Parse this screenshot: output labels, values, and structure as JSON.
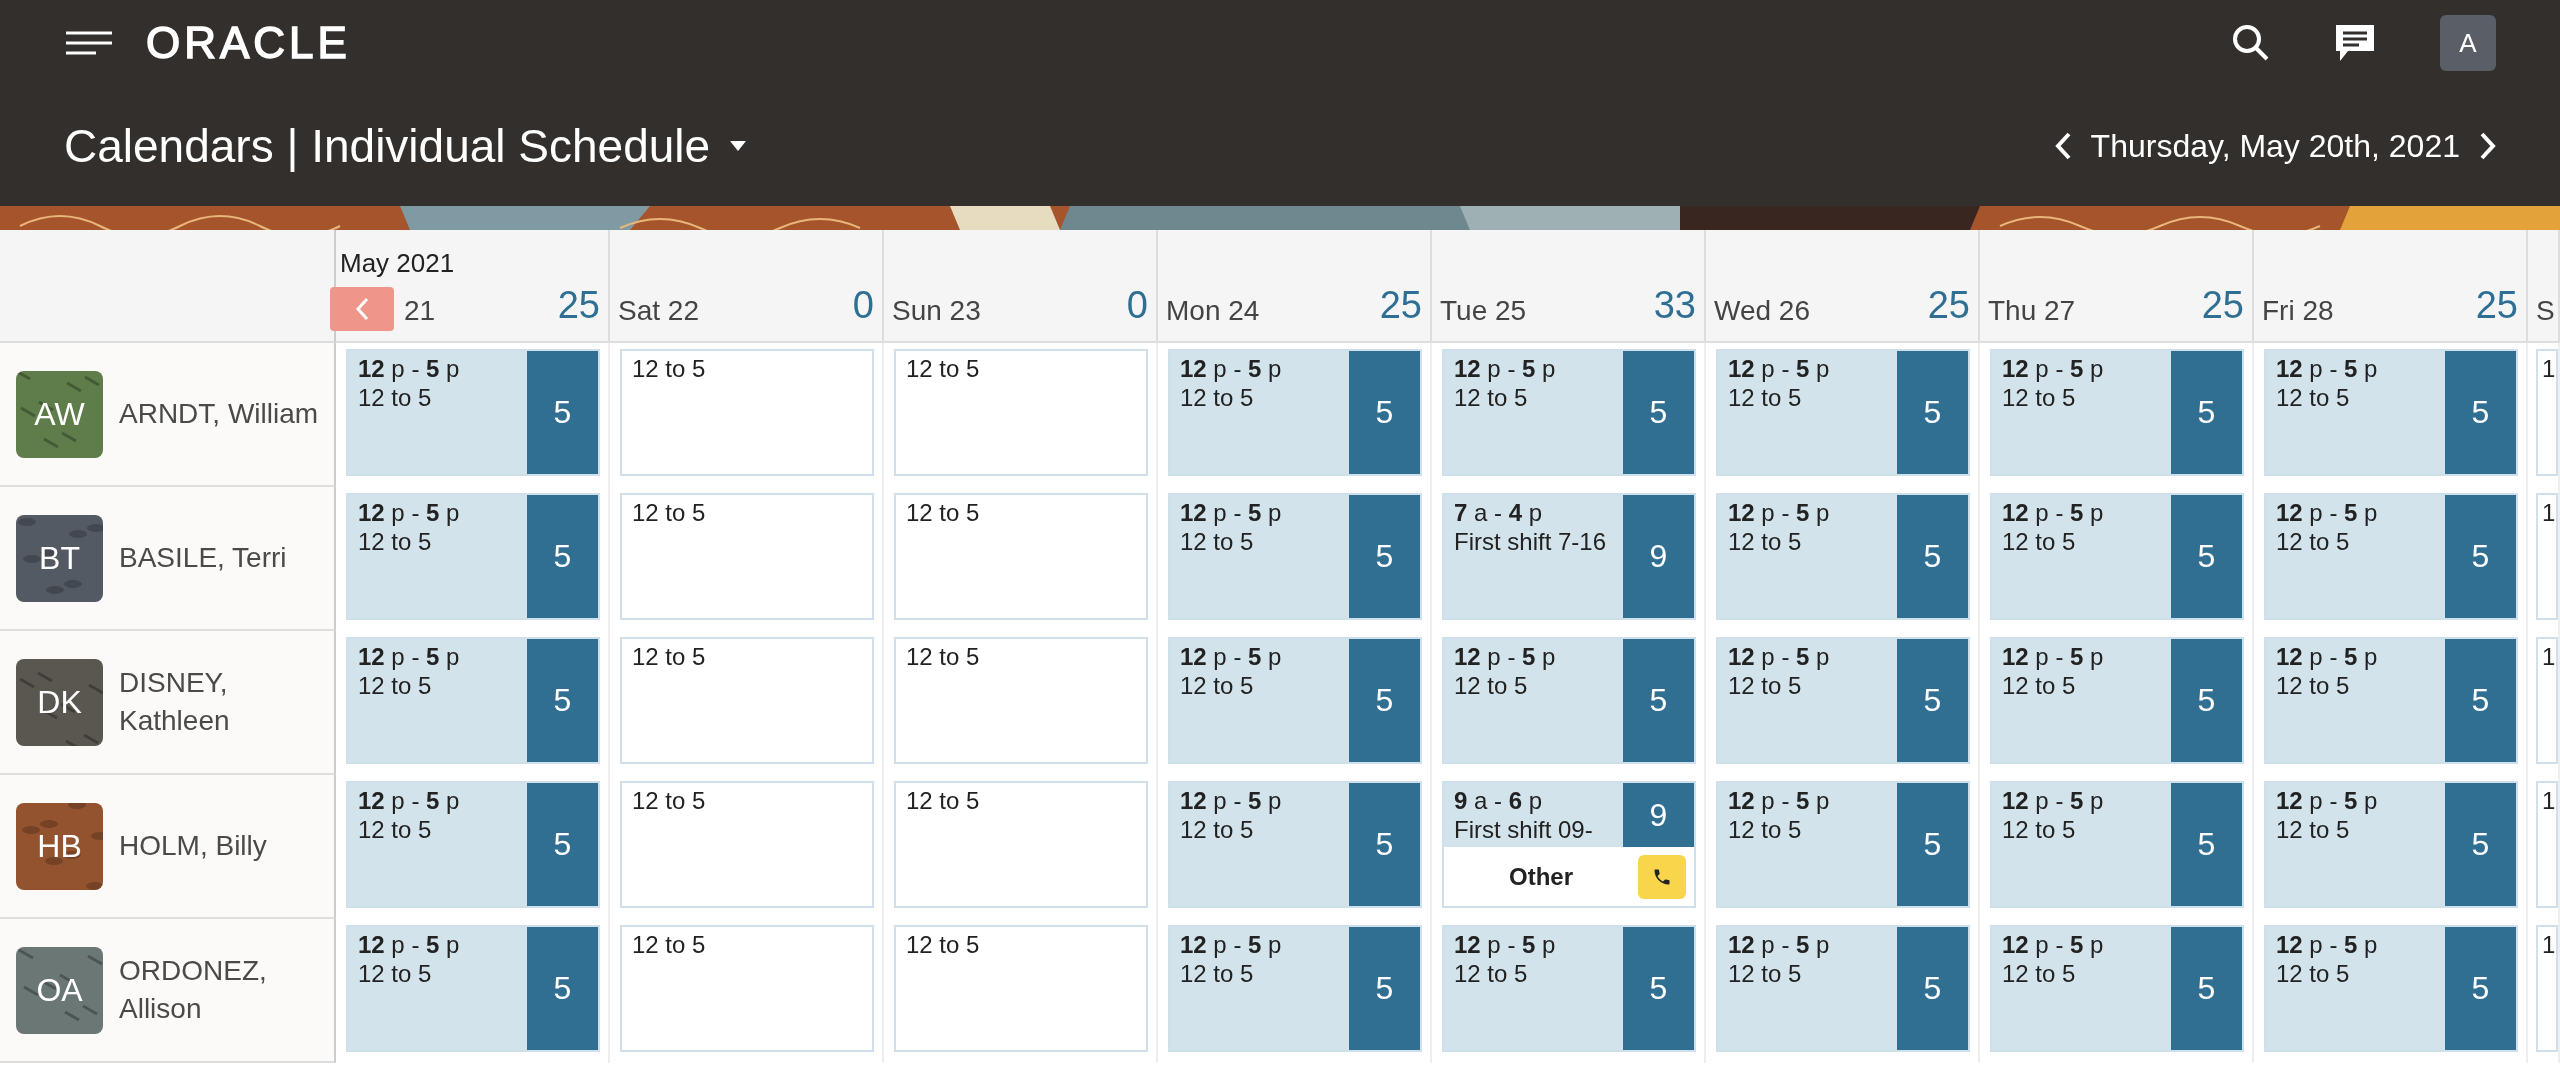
{
  "header": {
    "logo": "ORACLE",
    "title": "Calendars | Individual Schedule",
    "date": "Thursday, May 20th, 2021",
    "user_initial": "A"
  },
  "calendar": {
    "month": "May 2021",
    "days": [
      {
        "label": "21",
        "total": "25"
      },
      {
        "label": "Sat 22",
        "total": "0"
      },
      {
        "label": "Sun 23",
        "total": "0"
      },
      {
        "label": "Mon 24",
        "total": "25"
      },
      {
        "label": "Tue 25",
        "total": "33"
      },
      {
        "label": "Wed 26",
        "total": "25"
      },
      {
        "label": "Thu 27",
        "total": "25"
      },
      {
        "label": "Fri 28",
        "total": "25"
      },
      {
        "label": "S"
      }
    ],
    "people": [
      {
        "initials": "AW",
        "name": "ARNDT, William",
        "color": "#5e7d4a",
        "cells": [
          {
            "kind": "shift",
            "time": "**12** p - **5** p",
            "note": "12 to 5",
            "count": "5"
          },
          {
            "kind": "plain",
            "note": "12 to 5"
          },
          {
            "kind": "plain",
            "note": "12 to 5"
          },
          {
            "kind": "shift",
            "time": "**12** p - **5** p",
            "note": "12 to 5",
            "count": "5"
          },
          {
            "kind": "shift",
            "time": "**12** p - **5** p",
            "note": "12 to 5",
            "count": "5"
          },
          {
            "kind": "shift",
            "time": "**12** p - **5** p",
            "note": "12 to 5",
            "count": "5"
          },
          {
            "kind": "shift",
            "time": "**12** p - **5** p",
            "note": "12 to 5",
            "count": "5"
          },
          {
            "kind": "shift",
            "time": "**12** p - **5** p",
            "note": "12 to 5",
            "count": "5"
          },
          {
            "kind": "plain",
            "note": "1"
          }
        ]
      },
      {
        "initials": "BT",
        "name": "BASILE, Terri",
        "color": "#545a64",
        "cells": [
          {
            "kind": "shift",
            "time": "**12** p - **5** p",
            "note": "12 to 5",
            "count": "5"
          },
          {
            "kind": "plain",
            "note": "12 to 5"
          },
          {
            "kind": "plain",
            "note": "12 to 5"
          },
          {
            "kind": "shift",
            "time": "**12** p - **5** p",
            "note": "12 to 5",
            "count": "5"
          },
          {
            "kind": "shift",
            "time": "**7** a - **4** p",
            "note": "First shift 7-16",
            "count": "9"
          },
          {
            "kind": "shift",
            "time": "**12** p - **5** p",
            "note": "12 to 5",
            "count": "5"
          },
          {
            "kind": "shift",
            "time": "**12** p - **5** p",
            "note": "12 to 5",
            "count": "5"
          },
          {
            "kind": "shift",
            "time": "**12** p - **5** p",
            "note": "12 to 5",
            "count": "5"
          },
          {
            "kind": "plain",
            "note": "1"
          }
        ]
      },
      {
        "initials": "DK",
        "name": "DISNEY, Kathleen",
        "color": "#5a5650",
        "cells": [
          {
            "kind": "shift",
            "time": "**12** p - **5** p",
            "note": "12 to 5",
            "count": "5"
          },
          {
            "kind": "plain",
            "note": "12 to 5"
          },
          {
            "kind": "plain",
            "note": "12 to 5"
          },
          {
            "kind": "shift",
            "time": "**12** p - **5** p",
            "note": "12 to 5",
            "count": "5"
          },
          {
            "kind": "shift",
            "time": "**12** p - **5** p",
            "note": "12 to 5",
            "count": "5"
          },
          {
            "kind": "shift",
            "time": "**12** p - **5** p",
            "note": "12 to 5",
            "count": "5"
          },
          {
            "kind": "shift",
            "time": "**12** p - **5** p",
            "note": "12 to 5",
            "count": "5"
          },
          {
            "kind": "shift",
            "time": "**12** p - **5** p",
            "note": "12 to 5",
            "count": "5"
          },
          {
            "kind": "plain",
            "note": "1"
          }
        ]
      },
      {
        "initials": "HB",
        "name": "HOLM, Billy",
        "color": "#93532f",
        "cells": [
          {
            "kind": "shift",
            "time": "**12** p - **5** p",
            "note": "12 to 5",
            "count": "5"
          },
          {
            "kind": "plain",
            "note": "12 to 5"
          },
          {
            "kind": "plain",
            "note": "12 to 5"
          },
          {
            "kind": "shift",
            "time": "**12** p - **5** p",
            "note": "12 to 5",
            "count": "5"
          },
          {
            "kind": "shift_other",
            "time": "**9** a - **6** p",
            "note": "First shift 09-",
            "count": "9",
            "other": "Other"
          },
          {
            "kind": "shift",
            "time": "**12** p - **5** p",
            "note": "12 to 5",
            "count": "5"
          },
          {
            "kind": "shift",
            "time": "**12** p - **5** p",
            "note": "12 to 5",
            "count": "5"
          },
          {
            "kind": "shift",
            "time": "**12** p - **5** p",
            "note": "12 to 5",
            "count": "5"
          },
          {
            "kind": "plain",
            "note": "1"
          }
        ]
      },
      {
        "initials": "OA",
        "name": "ORDONEZ, Allison",
        "color": "#6b7775",
        "cells": [
          {
            "kind": "shift",
            "time": "**12** p - **5** p",
            "note": "12 to 5",
            "count": "5"
          },
          {
            "kind": "plain",
            "note": "12 to 5"
          },
          {
            "kind": "plain",
            "note": "12 to 5"
          },
          {
            "kind": "shift",
            "time": "**12** p - **5** p",
            "note": "12 to 5",
            "count": "5"
          },
          {
            "kind": "shift",
            "time": "**12** p - **5** p",
            "note": "12 to 5",
            "count": "5"
          },
          {
            "kind": "shift",
            "time": "**12** p - **5** p",
            "note": "12 to 5",
            "count": "5"
          },
          {
            "kind": "shift",
            "time": "**12** p - **5** p",
            "note": "12 to 5",
            "count": "5"
          },
          {
            "kind": "shift",
            "time": "**12** p - **5** p",
            "note": "12 to 5",
            "count": "5"
          },
          {
            "kind": "plain",
            "note": "1"
          }
        ]
      }
    ]
  }
}
